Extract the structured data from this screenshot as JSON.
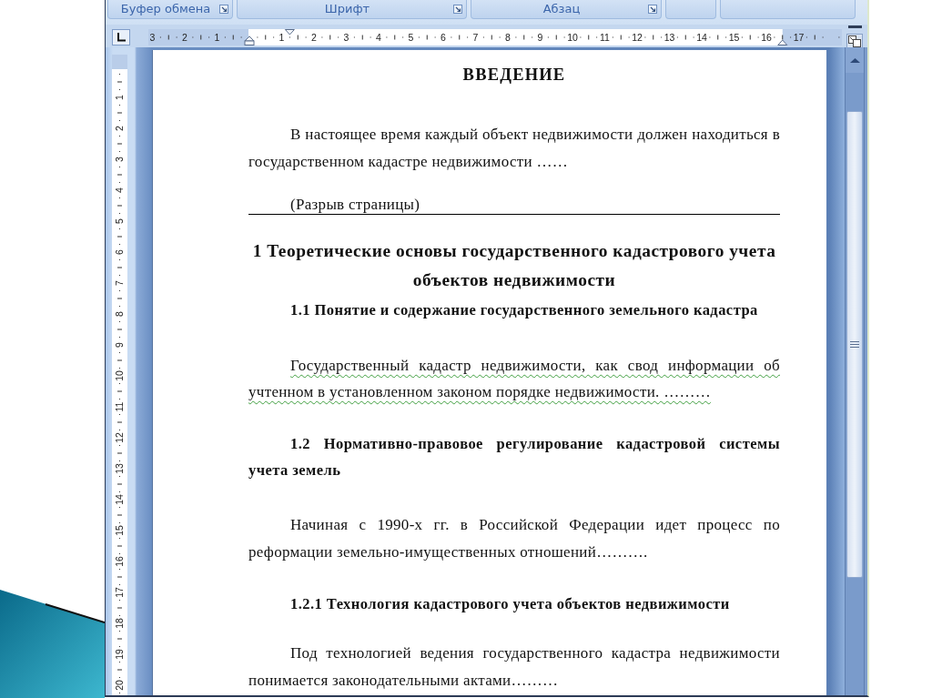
{
  "ribbon_groups": [
    {
      "label": "Буфер обмена",
      "launcher": true
    },
    {
      "label": "Шрифт",
      "launcher": true
    },
    {
      "label": "Абзац",
      "launcher": true
    },
    {
      "launcher": false
    },
    {
      "launcher": false
    }
  ],
  "horizontal_ruler": {
    "left_margin_labels": [
      "3",
      "2",
      "1"
    ],
    "labels": [
      "1",
      "2",
      "3",
      "4",
      "5",
      "6",
      "7",
      "8",
      "9",
      "10",
      "11",
      "12",
      "13",
      "14",
      "15",
      "16"
    ],
    "right_margin_labels": [
      "17"
    ]
  },
  "vertical_ruler": {
    "labels": [
      "1",
      "2",
      "3",
      "4",
      "5",
      "6",
      "7",
      "8",
      "9",
      "10",
      "11",
      "12",
      "13",
      "14",
      "15",
      "16",
      "17",
      "18",
      "19",
      "20"
    ]
  },
  "document": {
    "blocks": [
      {
        "kind": "title",
        "text": "ВВЕДЕНИЕ"
      },
      {
        "kind": "paragraph",
        "text": "В настоящее время каждый объект недвижимости должен находиться в государственном кадастре недвижимости ……",
        "grammar_error": false
      },
      {
        "kind": "page_break",
        "text": "(Разрыв страницы)"
      },
      {
        "kind": "heading1",
        "text": "1 Теоретические основы государственного кадастрового учета объектов недвижимости"
      },
      {
        "kind": "heading2",
        "text": "1.1 Понятие и содержание государственного земельного кадастра"
      },
      {
        "kind": "paragraph",
        "text": "Государственный кадастр недвижимости, как свод информации об учтенном в установленном законом порядке недвижимости. ………",
        "grammar_error": true
      },
      {
        "kind": "heading2",
        "text": "1.2 Нормативно-правовое регулирование кадастровой системы учета земель"
      },
      {
        "kind": "paragraph",
        "text": "Начиная с 1990-х гг. в Российской Федерации идет процесс по реформации земельно-имущественных отношений……….",
        "grammar_error": false
      },
      {
        "kind": "heading2",
        "text": "1.2.1 Технология кадастрового учета объектов недвижимости"
      },
      {
        "kind": "paragraph",
        "text": "Под технологией ведения государственного кадастра недвижимости понимается законодательными актами………",
        "grammar_error": false
      }
    ]
  }
}
